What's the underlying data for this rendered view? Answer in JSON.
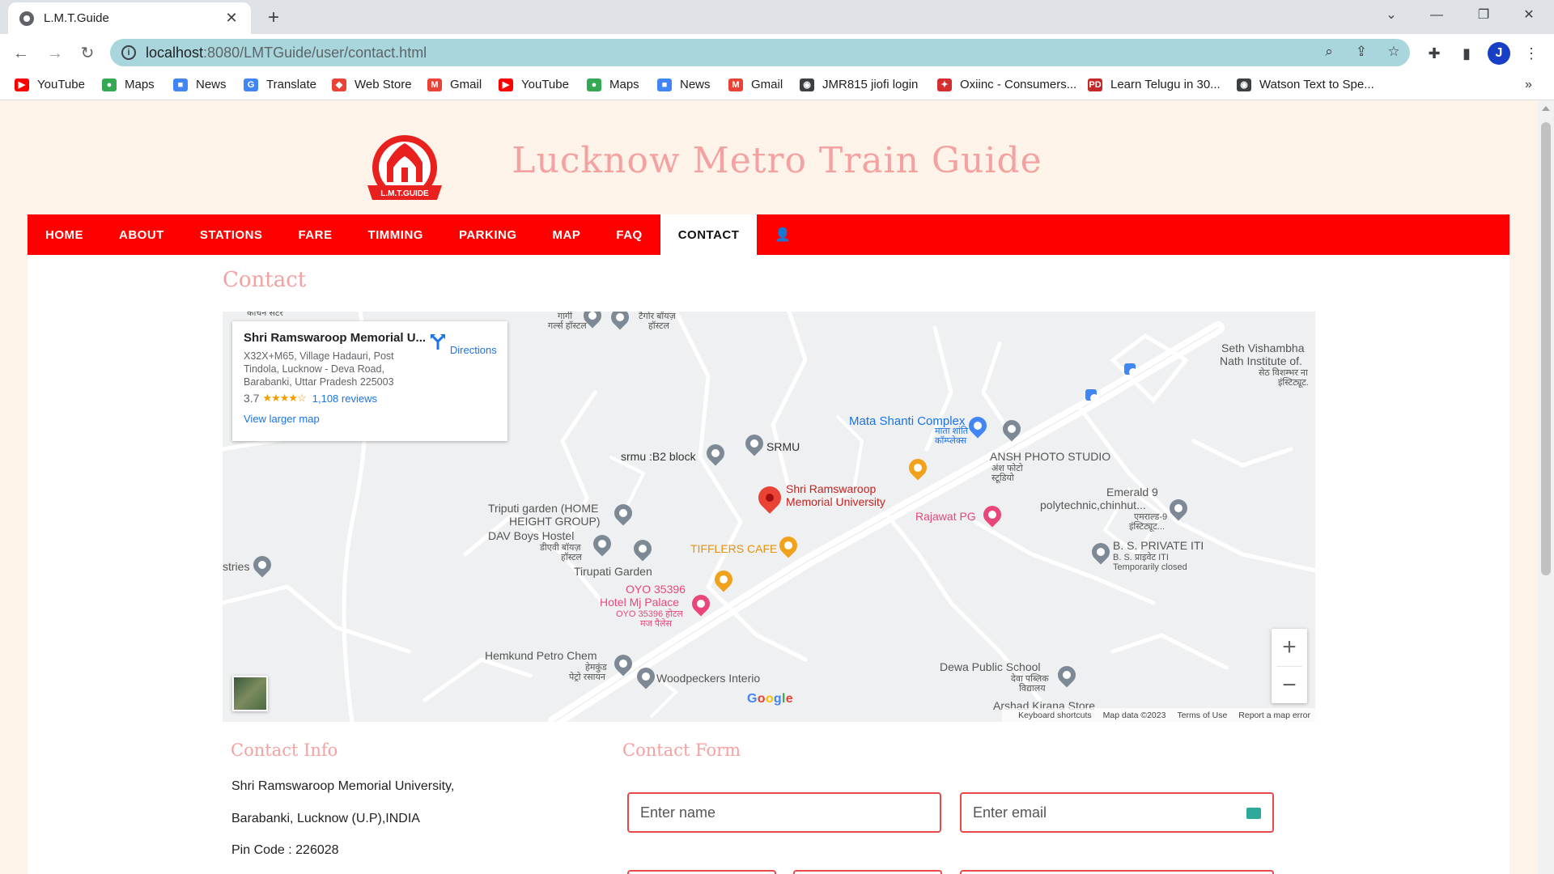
{
  "browser": {
    "tab_title": "L.M.T.Guide",
    "url_host": "localhost",
    "url_path": ":8080/LMTGuide/user/contact.html",
    "bookmarks": [
      {
        "label": "YouTube",
        "icon": "youtube-icon",
        "color": "#ff0000"
      },
      {
        "label": "Maps",
        "icon": "maps-icon",
        "color": "#34a853"
      },
      {
        "label": "News",
        "icon": "news-icon",
        "color": "#4285f4"
      },
      {
        "label": "Translate",
        "icon": "translate-icon",
        "color": "#4285f4"
      },
      {
        "label": "Web Store",
        "icon": "webstore-icon",
        "color": "#ea4335"
      },
      {
        "label": "Gmail",
        "icon": "gmail-icon",
        "color": "#ea4335"
      },
      {
        "label": "YouTube",
        "icon": "youtube-icon",
        "color": "#ff0000"
      },
      {
        "label": "Maps",
        "icon": "maps-icon",
        "color": "#34a853"
      },
      {
        "label": "News",
        "icon": "news-icon",
        "color": "#4285f4"
      },
      {
        "label": "Gmail",
        "icon": "gmail-icon",
        "color": "#ea4335"
      },
      {
        "label": "JMR815 jiofi login",
        "icon": "globe-icon",
        "color": "#3c4043"
      },
      {
        "label": "Oxiinc - Consumers...",
        "icon": "oxiinc-icon",
        "color": "#d32f2f"
      },
      {
        "label": "Learn Telugu in 30...",
        "icon": "pd-icon",
        "color": "#c62828"
      },
      {
        "label": "Watson Text to Spe...",
        "icon": "globe-icon",
        "color": "#3c4043"
      }
    ]
  },
  "site": {
    "title": "Lucknow Metro Train Guide",
    "logo_text": "L.M.T.GUIDE",
    "brand_color": "#ff0000"
  },
  "nav": [
    "HOME",
    "ABOUT",
    "STATIONS",
    "FARE",
    "TIMMING",
    "PARKING",
    "MAP",
    "FAQ",
    "CONTACT"
  ],
  "page": {
    "heading": "Contact"
  },
  "map": {
    "place_name": "Shri Ramswaroop Memorial U...",
    "address": "X32X+M65, Village Hadauri, Post Tindola, Lucknow - Deva Road, Barabanki, Uttar Pradesh 225003",
    "rating": "3.7",
    "stars": "★★★★☆",
    "reviews": "1,108 reviews",
    "view_larger": "View larger map",
    "directions": "Directions",
    "google": "Google",
    "footer": [
      "Keyboard shortcuts",
      "Map data ©2023",
      "Terms of Use",
      "Report a map error"
    ],
    "labels": {
      "top_left": "कांचन सेंटर",
      "gargi": "गार्गी",
      "girls_hostel": "गर्ल्स हॉस्टल",
      "tagore": "टैगोर बॉयज़",
      "tagore2": "हॉस्टल",
      "seth1": "Seth Vishambha",
      "seth2": "Nath Institute of.",
      "seth3": "सेठ विशम्भर ना",
      "seth4": "इंस्टिट्यूट.",
      "mata": "Mata Shanti Complex",
      "mata2": "माता शांति",
      "mata3": "कॉम्प्लेक्स",
      "srmu": "SRMU",
      "b2": "srmu :B2 block",
      "ansh": "ANSH PHOTO STUDIO",
      "ansh2": "अंश फोटो",
      "ansh3": "स्टूडियो",
      "shri1": "Shri Ramswaroop",
      "shri2": "Memorial University",
      "triputi1": "Triputi garden (HOME",
      "triputi2": "HEIGHT GROUP)",
      "emerald1": "Emerald 9",
      "emerald2": "polytechnic,chinhut...",
      "emerald3": "एमराल्ड-9",
      "emerald4": "इंस्टिट्यूट...",
      "rajawat": "Rajawat PG",
      "dav": "DAV Boys Hostel",
      "dav2": "डीएवी बॉयज़",
      "dav3": "हॉस्टल",
      "tiffler": "TIFFLERS CAFE",
      "bs1": "B. S. PRIVATE ITI",
      "bs2": "B. S. प्राइवेट ITI",
      "bs3": "Temporarily closed",
      "stries": "stries",
      "tirupati": "Tirupati Garden",
      "oyo1": "OYO 35396",
      "oyo2": "Hotel Mj Palace",
      "oyo3": "OYO 35396 होटल",
      "oyo4": "मज पैलेस",
      "hemkund": "Hemkund Petro Chem",
      "hemkund2": "हेमकुंड",
      "hemkund3": "पेट्रो रसायन",
      "wood": "Woodpeckers Interio",
      "dewa": "Dewa Public School",
      "dewa2": "देवा पब्लिक",
      "dewa3": "विद्यालय",
      "arshad": "Arshad Kirana Store"
    }
  },
  "contact_info": {
    "heading": "Contact Info",
    "line1": "Shri Ramswaroop Memorial University,",
    "line2": "Barabanki, Lucknow (U.P),INDIA",
    "line3": "Pin Code : 226028"
  },
  "contact_form": {
    "heading": "Contact Form",
    "name_placeholder": "Enter name",
    "email_placeholder": "Enter email"
  }
}
